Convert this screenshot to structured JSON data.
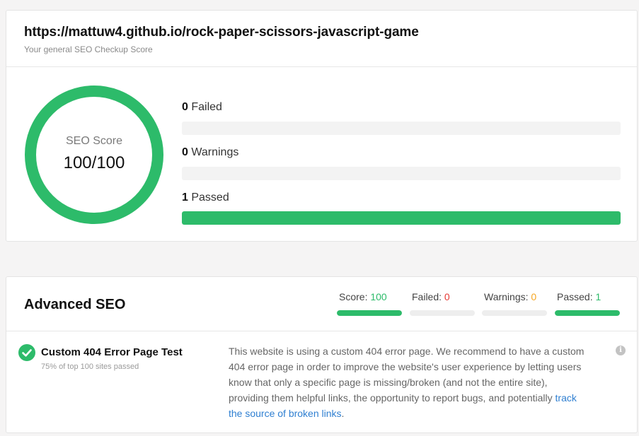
{
  "header": {
    "url": "https://mattuw4.github.io/rock-paper-scissors-javascript-game",
    "subtitle": "Your general SEO Checkup Score"
  },
  "score": {
    "label": "SEO Score",
    "value": "100/100",
    "fraction": 1.0
  },
  "stats": [
    {
      "count": "0",
      "label": "Failed",
      "fraction": 0.0
    },
    {
      "count": "0",
      "label": "Warnings",
      "fraction": 0.0
    },
    {
      "count": "1",
      "label": "Passed",
      "fraction": 1.0
    }
  ],
  "advanced": {
    "title": "Advanced SEO",
    "summary": [
      {
        "label": "Score:",
        "value": "100",
        "color": "#2dbb6a",
        "fraction": 1.0
      },
      {
        "label": "Failed:",
        "value": "0",
        "color": "#e53935",
        "fraction": 0.0
      },
      {
        "label": "Warnings:",
        "value": "0",
        "color": "#f5a623",
        "fraction": 0.0
      },
      {
        "label": "Passed:",
        "value": "1",
        "color": "#2dbb6a",
        "fraction": 1.0
      }
    ],
    "test": {
      "name": "Custom 404 Error Page Test",
      "sub": "75% of top 100 sites passed",
      "status_icon": "check-circle-icon",
      "description": "This website is using a custom 404 error page. We recommend to have a custom 404 error page in order to improve the website's user experience by letting users know that only a specific page is missing/broken (and not the entire site), providing them helpful links, the opportunity to report bugs, and potentially ",
      "link_text": "track the source of broken links",
      "after_link": ".",
      "info_icon": "info-icon"
    }
  },
  "colors": {
    "accent": "#2dbb6a",
    "link": "#2f7fd1"
  }
}
